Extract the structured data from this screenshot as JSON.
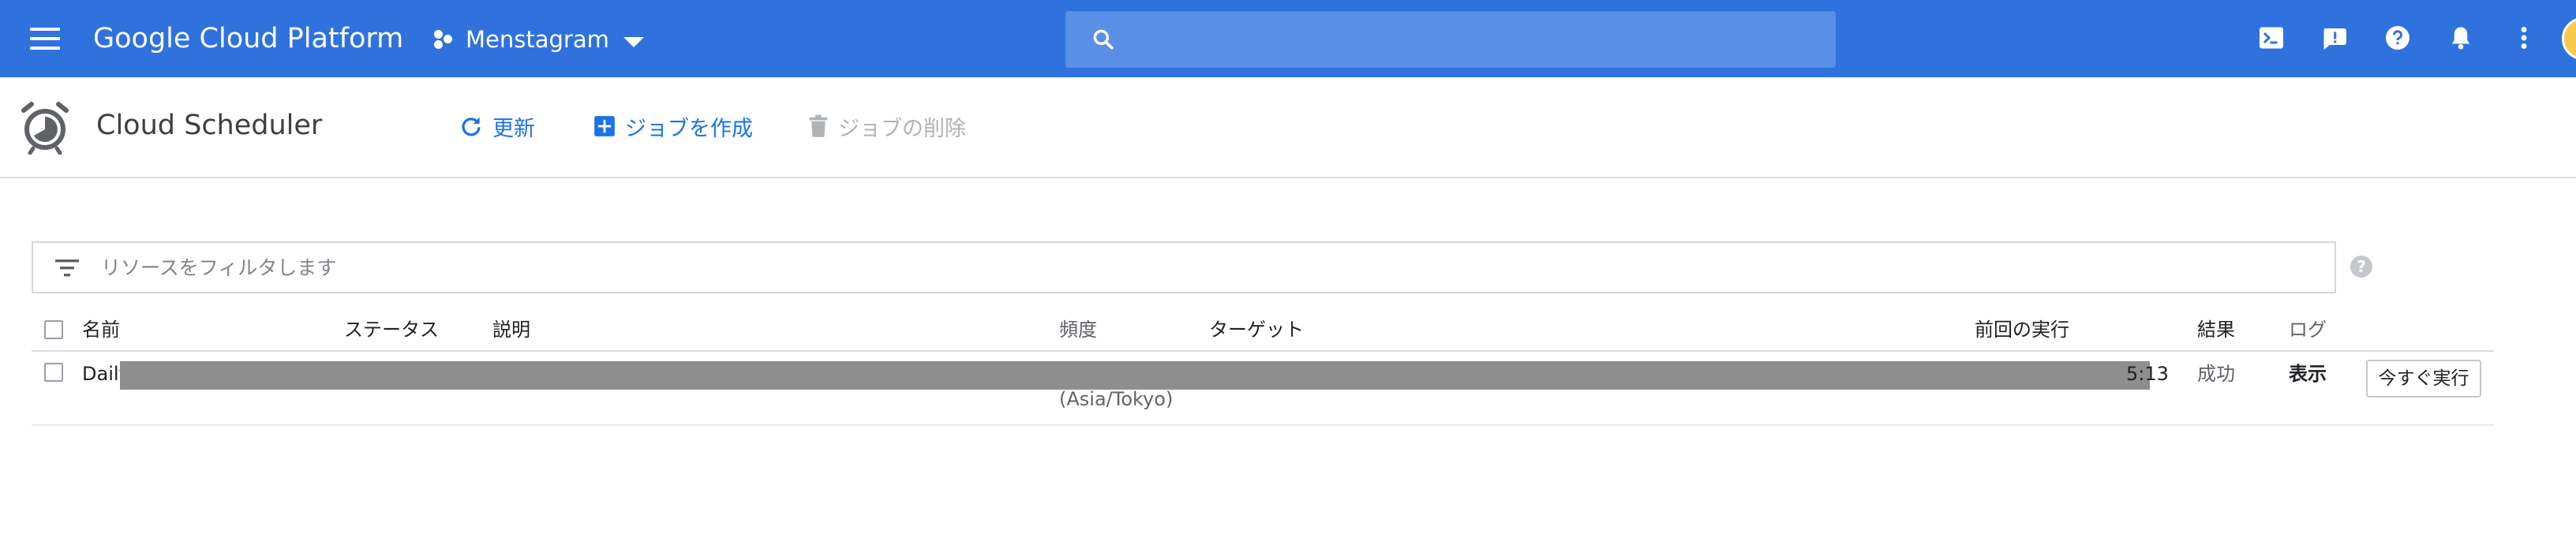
{
  "topbar": {
    "brand": "Google Cloud Platform",
    "project_name": "Menstagram",
    "icons": [
      "menu-icon",
      "project-icon",
      "dropdown-caret-icon",
      "search-icon",
      "cloud-shell-icon",
      "feedback-icon",
      "help-icon",
      "notifications-icon",
      "more-vert-icon",
      "avatar"
    ],
    "accent_color": "#2f72de"
  },
  "subheader": {
    "title": "Cloud Scheduler",
    "actions": {
      "refresh": "更新",
      "create_job": "ジョブを作成",
      "delete_job": "ジョブの削除"
    }
  },
  "filter": {
    "placeholder": "リソースをフィルタします"
  },
  "table": {
    "headers": {
      "name": "名前",
      "status": "ステータス",
      "description": "説明",
      "frequency": "頻度",
      "target": "ターゲット",
      "last_run": "前回の実行",
      "result": "結果",
      "log": "ログ"
    },
    "rows": [
      {
        "name": "Daily",
        "timezone": "(Asia/Tokyo)",
        "last_run_partial": "5:13",
        "result": "成功",
        "log": "表示",
        "run_now": "今すぐ実行"
      }
    ]
  }
}
